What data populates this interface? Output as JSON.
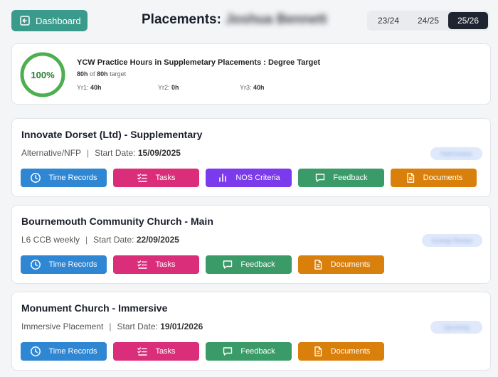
{
  "header": {
    "dashboard_label": "Dashboard",
    "title_prefix": "Placements:",
    "student_name": "Joshua Bennett",
    "years": [
      "23/24",
      "24/25",
      "25/26"
    ],
    "active_year": "25/26"
  },
  "summary": {
    "percent_label": "100%",
    "percent_value": 100,
    "title": "YCW Practice Hours in Supplemetary Placements : Degree Target",
    "hours_done": "80h",
    "of_text": "of",
    "hours_target": "80h",
    "target_text": "target",
    "yr1_label": "Yr1:",
    "yr1_value": "40h",
    "yr2_label": "Yr2:",
    "yr2_value": "0h",
    "yr3_label": "Yr3:",
    "yr3_value": "40h"
  },
  "placements": [
    {
      "title": "Innovate Dorset (Ltd) - Supplementary",
      "type": "Alternative/NFP",
      "start_label": "Start Date:",
      "start_date": "15/09/2025",
      "status": "Hold Invoice",
      "buttons": [
        "Time Records",
        "Tasks",
        "NOS Criteria",
        "Feedback",
        "Documents"
      ]
    },
    {
      "title": "Bournemouth Community Church - Main",
      "type": "L6 CCB weekly",
      "start_label": "Start Date:",
      "start_date": "22/09/2025",
      "status": "Arrange Review",
      "buttons": [
        "Time Records",
        "Tasks",
        "Feedback",
        "Documents"
      ]
    },
    {
      "title": "Monument Church - Immersive",
      "type": "Immersive Placement",
      "start_label": "Start Date:",
      "start_date": "19/01/2026",
      "status": "Upcoming",
      "buttons": [
        "Time Records",
        "Tasks",
        "Feedback",
        "Documents"
      ]
    }
  ],
  "colors": {
    "teal": "#3a9a8c",
    "time_records": "#2f86d3",
    "tasks": "#db2e7a",
    "nos_criteria": "#7c3aed",
    "feedback": "#3a9a68",
    "documents": "#d9800c",
    "progress_ring": "#4caf50"
  },
  "icons": {
    "dashboard": "arrow-left-box-icon",
    "time_records": "clock-icon",
    "tasks": "checklist-icon",
    "nos_criteria": "bar-chart-icon",
    "feedback": "message-icon",
    "documents": "document-icon"
  }
}
